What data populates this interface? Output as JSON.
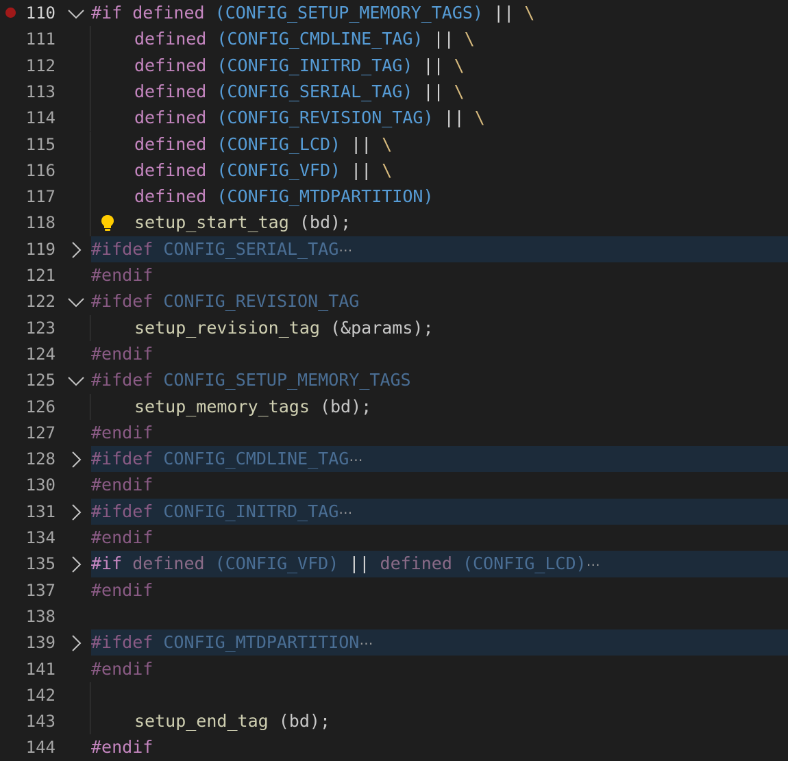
{
  "editor": {
    "lines": [
      {
        "num": "110",
        "fold": "open",
        "breakpoint": true,
        "dir": "#if",
        "def": "defined",
        "paren_open": "(",
        "macro": "CONFIG_SETUP_MEMORY_TAGS",
        "paren_close": ")",
        "op": "||",
        "bs": "\\"
      },
      {
        "num": "111",
        "def": "defined",
        "paren_open": "(",
        "macro": "CONFIG_CMDLINE_TAG",
        "paren_close": ")",
        "op": "||",
        "bs": "\\"
      },
      {
        "num": "112",
        "def": "defined",
        "paren_open": "(",
        "macro": "CONFIG_INITRD_TAG",
        "paren_close": ")",
        "op": "||",
        "bs": "\\"
      },
      {
        "num": "113",
        "def": "defined",
        "paren_open": "(",
        "macro": "CONFIG_SERIAL_TAG",
        "paren_close": ")",
        "op": "||",
        "bs": "\\"
      },
      {
        "num": "114",
        "def": "defined",
        "paren_open": "(",
        "macro": "CONFIG_REVISION_TAG",
        "paren_close": ")",
        "op": "||",
        "bs": "\\"
      },
      {
        "num": "115",
        "def": "defined",
        "paren_open": "(",
        "macro": "CONFIG_LCD",
        "paren_close": ")",
        "op": "||",
        "bs": "\\"
      },
      {
        "num": "116",
        "def": "defined",
        "paren_open": "(",
        "macro": "CONFIG_VFD",
        "paren_close": ")",
        "op": "||",
        "bs": "\\"
      },
      {
        "num": "117",
        "def": "defined",
        "paren_open": "(",
        "macro": "CONFIG_MTDPARTITION",
        "paren_close": ")"
      },
      {
        "num": "118",
        "call": "setup_start_tag",
        "args": "(bd);",
        "icon": "lightbulb-icon"
      },
      {
        "num": "119",
        "fold": "closed",
        "dir": "#ifdef",
        "macro": "CONFIG_SERIAL_TAG",
        "ellipsis": "⋯"
      },
      {
        "num": "121",
        "dir": "#endif"
      },
      {
        "num": "122",
        "fold": "open",
        "dir": "#ifdef",
        "macro": "CONFIG_REVISION_TAG"
      },
      {
        "num": "123",
        "call": "setup_revision_tag",
        "args": "(&params);"
      },
      {
        "num": "124",
        "dir": "#endif"
      },
      {
        "num": "125",
        "fold": "open",
        "dir": "#ifdef",
        "macro": "CONFIG_SETUP_MEMORY_TAGS"
      },
      {
        "num": "126",
        "call": "setup_memory_tags",
        "args": "(bd);"
      },
      {
        "num": "127",
        "dir": "#endif"
      },
      {
        "num": "128",
        "fold": "closed",
        "dir": "#ifdef",
        "macro": "CONFIG_CMDLINE_TAG",
        "ellipsis": "⋯"
      },
      {
        "num": "130",
        "dir": "#endif"
      },
      {
        "num": "131",
        "fold": "closed",
        "dir": "#ifdef",
        "macro": "CONFIG_INITRD_TAG",
        "ellipsis": "⋯"
      },
      {
        "num": "134",
        "dir": "#endif"
      },
      {
        "num": "135",
        "fold": "closed",
        "dir": "#if",
        "def": "defined",
        "paren_open": "(",
        "macro": "CONFIG_VFD",
        "paren_close": ")",
        "op": "||",
        "def2": "defined",
        "paren_open2": "(",
        "macro2": "CONFIG_LCD",
        "paren_close2": ")",
        "ellipsis": "⋯"
      },
      {
        "num": "137",
        "dir": "#endif"
      },
      {
        "num": "138"
      },
      {
        "num": "139",
        "fold": "closed",
        "dir": "#ifdef",
        "macro": "CONFIG_MTDPARTITION",
        "ellipsis": "⋯"
      },
      {
        "num": "141",
        "dir": "#endif"
      },
      {
        "num": "142"
      },
      {
        "num": "143",
        "call": "setup_end_tag",
        "args": "(bd);"
      },
      {
        "num": "144",
        "dir": "#endif",
        "dir_bright": true
      }
    ]
  },
  "colors": {
    "background": "#1e1e1e",
    "folded_highlight": "#1c2b3a",
    "keyword": "#c586c0",
    "macro": "#569cd6",
    "backslash": "#d7ba7d",
    "function": "#dcdcaa",
    "breakpoint": "#a01919",
    "lightbulb": "#ffcc00"
  }
}
